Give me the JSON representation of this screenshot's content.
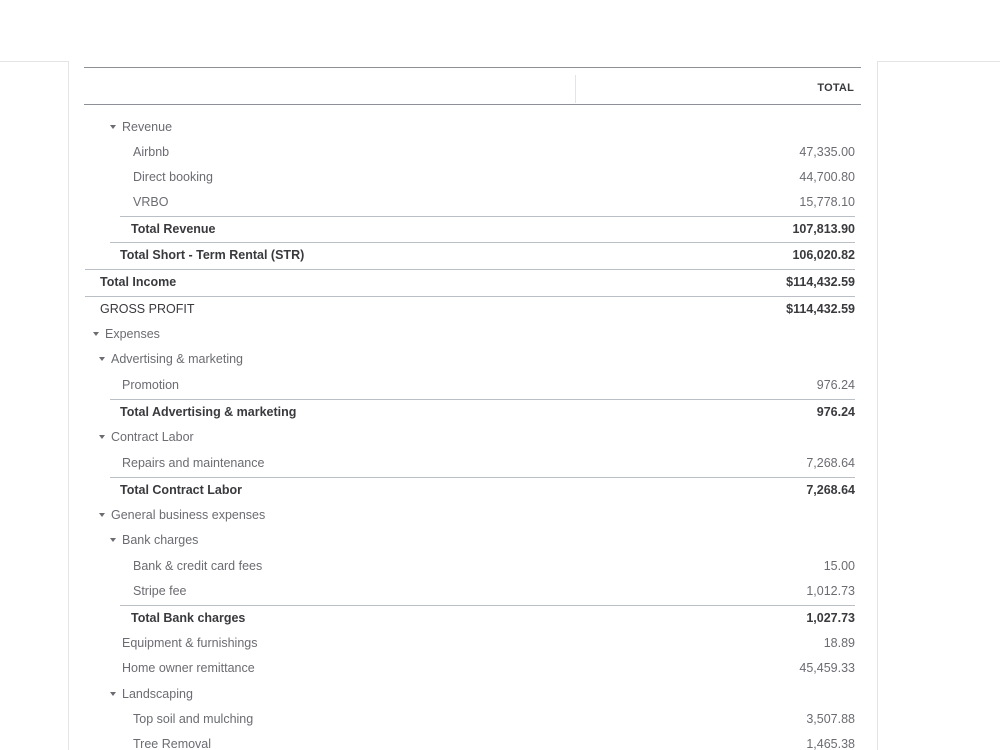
{
  "report": {
    "column_header": "TOTAL",
    "rows": [
      {
        "label": "Revenue",
        "value": ""
      },
      {
        "label": "Airbnb",
        "value": "47,335.00"
      },
      {
        "label": "Direct booking",
        "value": "44,700.80"
      },
      {
        "label": "VRBO",
        "value": "15,778.10"
      },
      {
        "label": "Total Revenue",
        "value": "107,813.90"
      },
      {
        "label": "Total Short - Term Rental (STR)",
        "value": "106,020.82"
      },
      {
        "label": "Total Income",
        "value": "$114,432.59"
      },
      {
        "label": "GROSS PROFIT",
        "value": "$114,432.59"
      },
      {
        "label": "Expenses",
        "value": ""
      },
      {
        "label": "Advertising & marketing",
        "value": ""
      },
      {
        "label": "Promotion",
        "value": "976.24"
      },
      {
        "label": "Total Advertising & marketing",
        "value": "976.24"
      },
      {
        "label": "Contract Labor",
        "value": ""
      },
      {
        "label": "Repairs and maintenance",
        "value": "7,268.64"
      },
      {
        "label": "Total Contract Labor",
        "value": "7,268.64"
      },
      {
        "label": "General business expenses",
        "value": ""
      },
      {
        "label": "Bank charges",
        "value": ""
      },
      {
        "label": "Bank & credit card fees",
        "value": "15.00"
      },
      {
        "label": "Stripe fee",
        "value": "1,012.73"
      },
      {
        "label": "Total Bank charges",
        "value": "1,027.73"
      },
      {
        "label": "Equipment & furnishings",
        "value": "18.89"
      },
      {
        "label": "Home owner remittance",
        "value": "45,459.33"
      },
      {
        "label": "Landscaping",
        "value": ""
      },
      {
        "label": "Top soil and mulching",
        "value": "3,507.88"
      },
      {
        "label": "Tree Removal",
        "value": "1,465.38"
      }
    ]
  },
  "icons": {
    "section_toggle": "caret-down-icon"
  },
  "colors": {
    "text": "#393a3d",
    "muted_text": "#6b6c72",
    "divider": "#babec5"
  }
}
